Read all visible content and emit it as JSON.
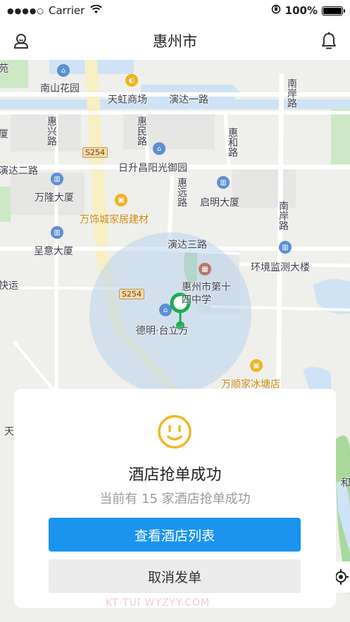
{
  "status_bar": {
    "signal": "●●●●○",
    "carrier": "Carrier",
    "battery": "100%"
  },
  "nav": {
    "title": "惠州市",
    "left_icon": "user-icon",
    "right_icon": "bell-icon"
  },
  "map": {
    "labels": {
      "nanshan_garden": "南山花园",
      "tianhong": "天虹商场",
      "yanda1": "演达一路",
      "nanan_road_top": "南岸路",
      "huixing": "惠兴路",
      "huimin": "惠民路",
      "huihe": "惠和路",
      "yanda2": "演达二路",
      "richeng": "日升昌阳光御园",
      "road_s254_a": "S254",
      "wanlong": "万隆大厦",
      "huiyuan": "惠远路",
      "qiming": "启明大厦",
      "wanshi": "万饰城家居建材",
      "nanan_road_mid": "南岸路",
      "chengyi": "呈意大厦",
      "yanda3": "演达三路",
      "env": "环境监测大楼",
      "kuaiyun": "快运",
      "road_s254_b": "S254",
      "school": "惠州市第十四中学",
      "deming": "德明·台立方",
      "wanshun": "万顺家冰塘店",
      "left_edge_1": "苑",
      "left_edge_2": "厦",
      "left_edge_3": "天",
      "right_edge": "和"
    }
  },
  "card": {
    "icon": "smiley-icon",
    "title": "酒店抢单成功",
    "subtitle": "当前有 15 家酒店抢单成功",
    "primary_button": "查看酒店列表",
    "secondary_button": "取消发单"
  },
  "watermark": "KT·TUI WYZYY.COM",
  "colors": {
    "accent": "#1b94ee",
    "pin": "#1aae4f",
    "smiley": "#f5b625",
    "map_bg": "#efefec",
    "water": "#cfe3f6"
  }
}
